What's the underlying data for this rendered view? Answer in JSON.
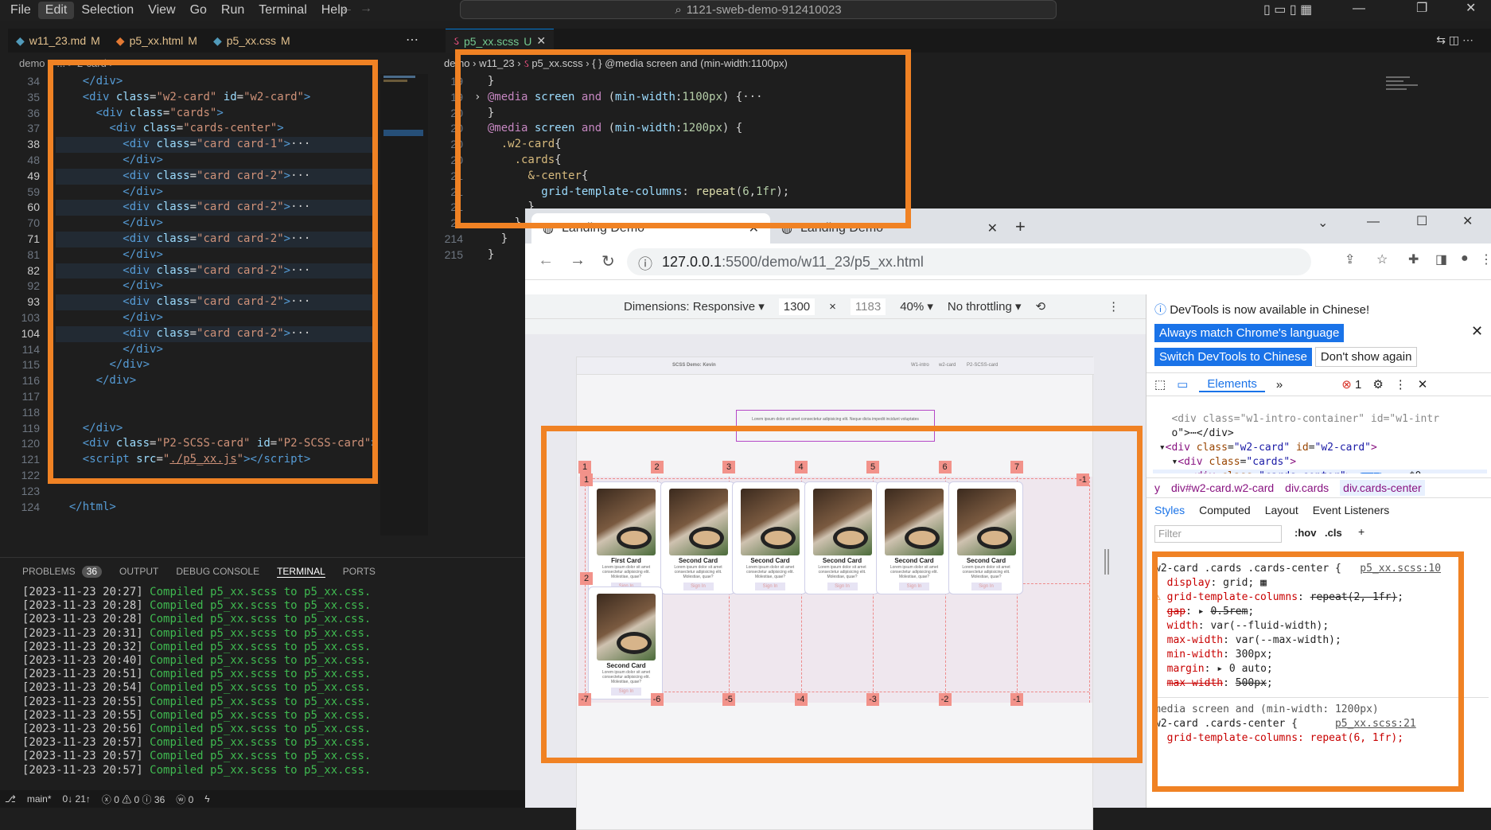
{
  "menu": [
    "File",
    "Edit",
    "Selection",
    "View",
    "Go",
    "Run",
    "Terminal",
    "Help"
  ],
  "command_center": "1121-sweb-demo-912410023",
  "editor_tabs": [
    {
      "name": "w11_23.md",
      "mark": "M",
      "color": "#519aba"
    },
    {
      "name": "p5_xx.html",
      "mark": "M",
      "color": "#e37933"
    },
    {
      "name": "p5_xx.css",
      "mark": "M",
      "color": "#519aba"
    },
    {
      "name": "p5_xx.scss",
      "mark": "U",
      "color": "#f55385"
    }
  ],
  "left_breadcrumb": "demo > ... > 2-card >",
  "right_breadcrumb": {
    "a": "demo",
    "b": "w11_23",
    "c": "p5_xx.scss",
    "d": "{ } @media screen and (min-width:1100px)"
  },
  "html_lines": [
    {
      "n": "34",
      "html": "    <span class='tag'>&lt;/div&gt;</span>"
    },
    {
      "n": "35",
      "html": "    <span class='tag'>&lt;div</span> <span class='attr'>class</span>=<span class='str'>\"w2-card\"</span> <span class='attr'>id</span>=<span class='str'>\"w2-card\"</span><span class='tag'>&gt;</span>"
    },
    {
      "n": "36",
      "html": "      <span class='tag'>&lt;div</span> <span class='attr'>class</span>=<span class='str'>\"cards\"</span><span class='tag'>&gt;</span>"
    },
    {
      "n": "37",
      "html": "        <span class='tag'>&lt;div</span> <span class='attr'>class</span>=<span class='str'>\"cards-center\"</span><span class='tag'>&gt;</span>"
    },
    {
      "n": "38",
      "html": "          <span class='tag'>&lt;div</span> <span class='attr'>class</span>=<span class='str'>\"card card-1\"</span><span class='tag'>&gt;</span>···"
    },
    {
      "n": "48",
      "html": "          <span class='tag'>&lt;/div&gt;</span>"
    },
    {
      "n": "49",
      "html": "          <span class='tag'>&lt;div</span> <span class='attr'>class</span>=<span class='str'>\"card card-2\"</span><span class='tag'>&gt;</span>···"
    },
    {
      "n": "59",
      "html": "          <span class='tag'>&lt;/div&gt;</span>"
    },
    {
      "n": "60",
      "html": "          <span class='tag'>&lt;div</span> <span class='attr'>class</span>=<span class='str'>\"card card-2\"</span><span class='tag'>&gt;</span>···"
    },
    {
      "n": "70",
      "html": "          <span class='tag'>&lt;/div&gt;</span>"
    },
    {
      "n": "71",
      "html": "          <span class='tag'>&lt;div</span> <span class='attr'>class</span>=<span class='str'>\"card card-2\"</span><span class='tag'>&gt;</span>···"
    },
    {
      "n": "81",
      "html": "          <span class='tag'>&lt;/div&gt;</span>"
    },
    {
      "n": "82",
      "html": "          <span class='tag'>&lt;div</span> <span class='attr'>class</span>=<span class='str'>\"card card-2\"</span><span class='tag'>&gt;</span>···"
    },
    {
      "n": "92",
      "html": "          <span class='tag'>&lt;/div&gt;</span>"
    },
    {
      "n": "93",
      "html": "          <span class='tag'>&lt;div</span> <span class='attr'>class</span>=<span class='str'>\"card card-2\"</span><span class='tag'>&gt;</span>···"
    },
    {
      "n": "103",
      "html": "          <span class='tag'>&lt;/div&gt;</span>"
    },
    {
      "n": "104",
      "html": "          <span class='tag'>&lt;div</span> <span class='attr'>class</span>=<span class='str'>\"card card-2\"</span><span class='tag'>&gt;</span>···"
    },
    {
      "n": "114",
      "html": "          <span class='tag'>&lt;/div&gt;</span>"
    },
    {
      "n": "115",
      "html": "        <span class='tag'>&lt;/div&gt;</span>"
    },
    {
      "n": "116",
      "html": "      <span class='tag'>&lt;/div&gt;</span>"
    },
    {
      "n": "117",
      "html": ""
    },
    {
      "n": "118",
      "html": ""
    },
    {
      "n": "119",
      "html": "    <span class='tag'>&lt;/div&gt;</span>"
    },
    {
      "n": "120",
      "html": "    <span class='tag'>&lt;div</span> <span class='attr'>class</span>=<span class='str'>\"P2-SCSS-card\"</span> <span class='attr'>id</span>=<span class='str'>\"P2-SCSS-card\"</span><span class='tag'>&gt;&lt;/</span>"
    },
    {
      "n": "121",
      "html": "    <span class='tag'>&lt;script</span> <span class='attr'>src</span>=<span class='str'>\"<u>./p5_xx.js</u>\"</span><span class='tag'>&gt;&lt;/script&gt;</span>"
    },
    {
      "n": "122",
      "html": ""
    },
    {
      "n": "123",
      "html": ""
    },
    {
      "n": "124",
      "html": "  <span class='tag'>&lt;/html&gt;</span>"
    }
  ],
  "scss_lines": [
    {
      "n": "19",
      "html": "  }"
    },
    {
      "n": "19",
      "html": "› <span class='kw'>@media</span> <span class='attr'>screen</span> <span class='kw'>and</span> (<span class='attr'>min-width</span>:<span class='num'>1100px</span>) {···"
    },
    {
      "n": "20",
      "html": "  }"
    },
    {
      "n": "20",
      "html": "  <span class='kw'>@media</span> <span class='attr'>screen</span> <span class='kw'>and</span> (<span class='attr'>min-width</span>:<span class='num'>1200px</span>) {"
    },
    {
      "n": "20",
      "html": "    <span class='sel'>.w2-card</span>{"
    },
    {
      "n": "20",
      "html": "      <span class='sel'>.cards</span>{"
    },
    {
      "n": "21",
      "html": "        <span class='sel'>&amp;-center</span>{"
    },
    {
      "n": "21",
      "html": "          <span class='attr'>grid-template-columns</span>: <span class='fn'>repeat</span>(<span class='num'>6</span>,<span class='num'>1fr</span>);"
    },
    {
      "n": "21",
      "html": "        }"
    },
    {
      "n": "21",
      "html": "      }"
    },
    {
      "n": "214",
      "html": "    }"
    },
    {
      "n": "215",
      "html": "  }"
    }
  ],
  "panel_tabs": [
    "PROBLEMS",
    "OUTPUT",
    "DEBUG CONSOLE",
    "TERMINAL",
    "PORTS"
  ],
  "problems_count": "36",
  "terminal": [
    {
      "ts": "[2023-11-23 20:27]",
      "msg": "Compiled p5_xx.scss to p5_xx.css."
    },
    {
      "ts": "[2023-11-23 20:28]",
      "msg": "Compiled p5_xx.scss to p5_xx.css."
    },
    {
      "ts": "[2023-11-23 20:28]",
      "msg": "Compiled p5_xx.scss to p5_xx.css."
    },
    {
      "ts": "[2023-11-23 20:31]",
      "msg": "Compiled p5_xx.scss to p5_xx.css."
    },
    {
      "ts": "[2023-11-23 20:32]",
      "msg": "Compiled p5_xx.scss to p5_xx.css."
    },
    {
      "ts": "[2023-11-23 20:40]",
      "msg": "Compiled p5_xx.scss to p5_xx.css."
    },
    {
      "ts": "[2023-11-23 20:51]",
      "msg": "Compiled p5_xx.scss to p5_xx.css."
    },
    {
      "ts": "[2023-11-23 20:54]",
      "msg": "Compiled p5_xx.scss to p5_xx.css."
    },
    {
      "ts": "[2023-11-23 20:55]",
      "msg": "Compiled p5_xx.scss to p5_xx.css."
    },
    {
      "ts": "[2023-11-23 20:55]",
      "msg": "Compiled p5_xx.scss to p5_xx.css."
    },
    {
      "ts": "[2023-11-23 20:56]",
      "msg": "Compiled p5_xx.scss to p5_xx.css."
    },
    {
      "ts": "[2023-11-23 20:57]",
      "msg": "Compiled p5_xx.scss to p5_xx.css."
    },
    {
      "ts": "[2023-11-23 20:57]",
      "msg": "Compiled p5_xx.scss to p5_xx.css."
    },
    {
      "ts": "[2023-11-23 20:57]",
      "msg": "Compiled p5_xx.scss to p5_xx.css."
    }
  ],
  "status": {
    "branch": "main*",
    "sync": "0↓ 21↑",
    "errors": "ⓧ 0 ⚠ 0 ⓘ 36",
    "ports": "ⓦ 0"
  },
  "browser": {
    "tabs": [
      "Landing Demo",
      "Landing Demo"
    ],
    "url_host": "127.0.0.1",
    "url_rest": ":5500/demo/w11_23/p5_xx.html",
    "dimensions": "Dimensions: Responsive",
    "width": "1300",
    "height": "1183",
    "zoom": "40%",
    "throttle": "No throttling"
  },
  "page": {
    "brand": "SCSS Demo: Kevin",
    "nav": [
      "W1-intro",
      "w2-card",
      "P2-SCSS-card"
    ],
    "intro": "Lorem ipsum dolor sit amet consectetur adipisicing elit. Neque dicta impedit incidunt voluptates"
  },
  "cards": [
    {
      "title": "First Card"
    },
    {
      "title": "Second Card"
    },
    {
      "title": "Second Card"
    },
    {
      "title": "Second Card"
    },
    {
      "title": "Second Card"
    },
    {
      "title": "Second Card"
    },
    {
      "title": "Second Card"
    }
  ],
  "card_desc": "Lorem ipsum dolor sit amet consectetur adipisicing elit. Molestiae, quae?",
  "card_btn": "Sign In",
  "grid_top": [
    "1",
    "2",
    "3",
    "4",
    "5",
    "6",
    "7"
  ],
  "grid_bottom": [
    "-7",
    "-6",
    "-5",
    "-4",
    "-3",
    "-2",
    "-1"
  ],
  "grid_rows": [
    "1",
    "2"
  ],
  "grid_rows_neg": [
    "-1"
  ],
  "devtools": {
    "notice": "DevTools is now available in Chinese!",
    "btn1": "Always match Chrome's language",
    "btn2": "Switch DevTools to Chinese",
    "btn3": "Don't show again",
    "tab": "Elements",
    "errors": "1",
    "crumbs": [
      "y",
      "div#w2-card.w2-card",
      "div.cards",
      "div.cards-center"
    ],
    "subtabs": [
      "Styles",
      "Computed",
      "Layout",
      "Event Listeners"
    ],
    "filter": "Filter",
    "hov": ":hov",
    "cls": ".cls",
    "rule1_sel": "w2-card .cards .cards-center {",
    "rule1_src": "p5_xx.scss:10",
    "rule2_media": "media screen and (min-width: 1200px)",
    "rule2_sel": "w2-card .cards-center {",
    "rule2_src": "p5_xx.scss:21",
    "rule2_prop": "grid-template-columns: repeat(6, 1fr);"
  }
}
